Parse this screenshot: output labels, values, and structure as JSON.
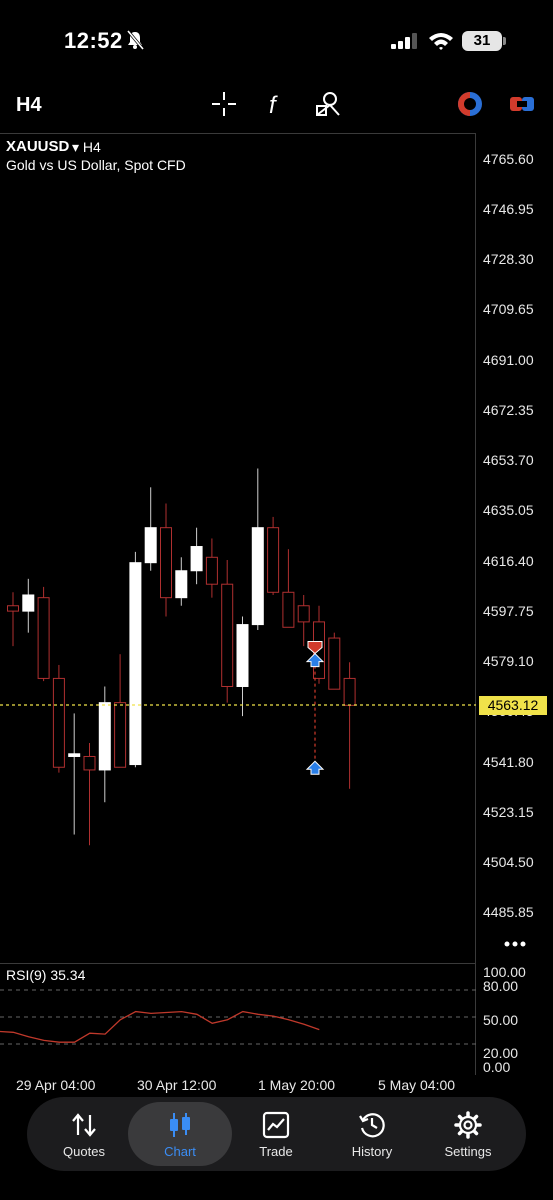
{
  "status": {
    "time": "12:52",
    "battery": "31"
  },
  "toolbar": {
    "timeframe": "H4"
  },
  "symbol": {
    "name": "XAUUSD",
    "arrow": "▾",
    "timeframe": "H4",
    "description": "Gold vs US Dollar, Spot CFD"
  },
  "price_axis": {
    "labels": [
      "4765.60",
      "4746.95",
      "4728.30",
      "4709.65",
      "4691.00",
      "4672.35",
      "4653.70",
      "4635.05",
      "4616.40",
      "4597.75",
      "4579.10",
      "4560.45",
      "4541.80",
      "4523.15",
      "4504.50",
      "4485.85"
    ],
    "current_price": "4563.12"
  },
  "rsi": {
    "title": "RSI(9) 35.34",
    "labels": [
      "100.00",
      "80.00",
      "50.00",
      "20.00",
      "0.00"
    ]
  },
  "time_axis": {
    "labels": [
      "29 Apr 04:00",
      "30 Apr 12:00",
      "1 May 20:00",
      "5 May 04:00"
    ]
  },
  "nav": {
    "items": [
      {
        "label": "Quotes",
        "icon": "arrows-updown-icon"
      },
      {
        "label": "Chart",
        "icon": "candles-icon"
      },
      {
        "label": "Trade",
        "icon": "trade-chart-icon"
      },
      {
        "label": "History",
        "icon": "history-clock-icon"
      },
      {
        "label": "Settings",
        "icon": "gear-icon"
      }
    ],
    "active": "Chart"
  },
  "colors": {
    "bull": "#ffffff",
    "bear": "#b03030",
    "current_line": "#f0e24a",
    "rsi": "#c0392b",
    "accent": "#3a8df5"
  },
  "chart_data": {
    "type": "candlestick",
    "symbol": "XAUUSD",
    "timeframe": "H4",
    "ylim": [
      4485.85,
      4765.6
    ],
    "candles": [
      {
        "o": 4600,
        "h": 4605,
        "l": 4585,
        "c": 4598
      },
      {
        "o": 4598,
        "h": 4610,
        "l": 4590,
        "c": 4604
      },
      {
        "o": 4603,
        "h": 4607,
        "l": 4572,
        "c": 4573
      },
      {
        "o": 4573,
        "h": 4578,
        "l": 4538,
        "c": 4540
      },
      {
        "o": 4544,
        "h": 4560,
        "l": 4515,
        "c": 4545
      },
      {
        "o": 4544,
        "h": 4549,
        "l": 4511,
        "c": 4539
      },
      {
        "o": 4539,
        "h": 4570,
        "l": 4527,
        "c": 4564
      },
      {
        "o": 4564,
        "h": 4582,
        "l": 4541,
        "c": 4540
      },
      {
        "o": 4541,
        "h": 4620,
        "l": 4540,
        "c": 4616
      },
      {
        "o": 4616,
        "h": 4644,
        "l": 4613,
        "c": 4629
      },
      {
        "o": 4629,
        "h": 4638,
        "l": 4596,
        "c": 4603
      },
      {
        "o": 4603,
        "h": 4618,
        "l": 4600,
        "c": 4613
      },
      {
        "o": 4613,
        "h": 4629,
        "l": 4608,
        "c": 4622
      },
      {
        "o": 4618,
        "h": 4625,
        "l": 4603,
        "c": 4608
      },
      {
        "o": 4608,
        "h": 4617,
        "l": 4564,
        "c": 4570
      },
      {
        "o": 4570,
        "h": 4596,
        "l": 4559,
        "c": 4593
      },
      {
        "o": 4593,
        "h": 4651,
        "l": 4591,
        "c": 4629
      },
      {
        "o": 4629,
        "h": 4633,
        "l": 4604,
        "c": 4605
      },
      {
        "o": 4605,
        "h": 4621,
        "l": 4593,
        "c": 4592
      },
      {
        "o": 4600,
        "h": 4604,
        "l": 4585,
        "c": 4594
      },
      {
        "o": 4594,
        "h": 4600,
        "l": 4571,
        "c": 4573
      },
      {
        "o": 4588,
        "h": 4590,
        "l": 4569,
        "c": 4569
      },
      {
        "o": 4573,
        "h": 4579,
        "l": 4532,
        "c": 4563
      }
    ],
    "current_price": 4563.12,
    "trade_markers": [
      {
        "type": "sell",
        "price": 4583
      },
      {
        "type": "buy",
        "price": 4580
      },
      {
        "type": "buy",
        "price": 4540
      }
    ],
    "rsi": {
      "period": 9,
      "last": 35.34,
      "ylim": [
        0,
        100
      ],
      "levels": [
        20,
        50,
        80
      ],
      "values": [
        34,
        33,
        28,
        24,
        22,
        22,
        32,
        31,
        47,
        56,
        54,
        55,
        56,
        53,
        43,
        47,
        56,
        53,
        51,
        47,
        42,
        36
      ]
    },
    "x_tick_labels": [
      "29 Apr 04:00",
      "30 Apr 12:00",
      "1 May 20:00",
      "5 May 04:00"
    ]
  }
}
